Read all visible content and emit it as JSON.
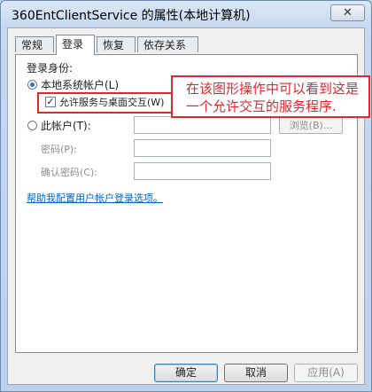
{
  "window": {
    "title": "360EntClientService 的属性(本地计算机)",
    "close_glyph": "✕"
  },
  "tabs": [
    {
      "label": "常规"
    },
    {
      "label": "登录"
    },
    {
      "label": "恢复"
    },
    {
      "label": "依存关系"
    }
  ],
  "logon": {
    "section_label": "登录身份:",
    "local_system": "本地系统帐户(L)",
    "allow_desktop": "允许服务与桌面交互(W)",
    "allow_desktop_checked": true,
    "this_account": "此帐户(T):",
    "browse_label": "浏览(B)...",
    "password_label": "密码(P):",
    "confirm_password_label": "确认密码(C):",
    "help_link": "帮助我配置用户帐户登录选项。"
  },
  "annotation": {
    "line1": "在该图形操作中可以看到这是",
    "line2": "一个允许交互的服务程序.",
    "color": "#e5262d"
  },
  "buttons": {
    "ok": "确定",
    "cancel": "取消",
    "apply": "应用(A)"
  }
}
